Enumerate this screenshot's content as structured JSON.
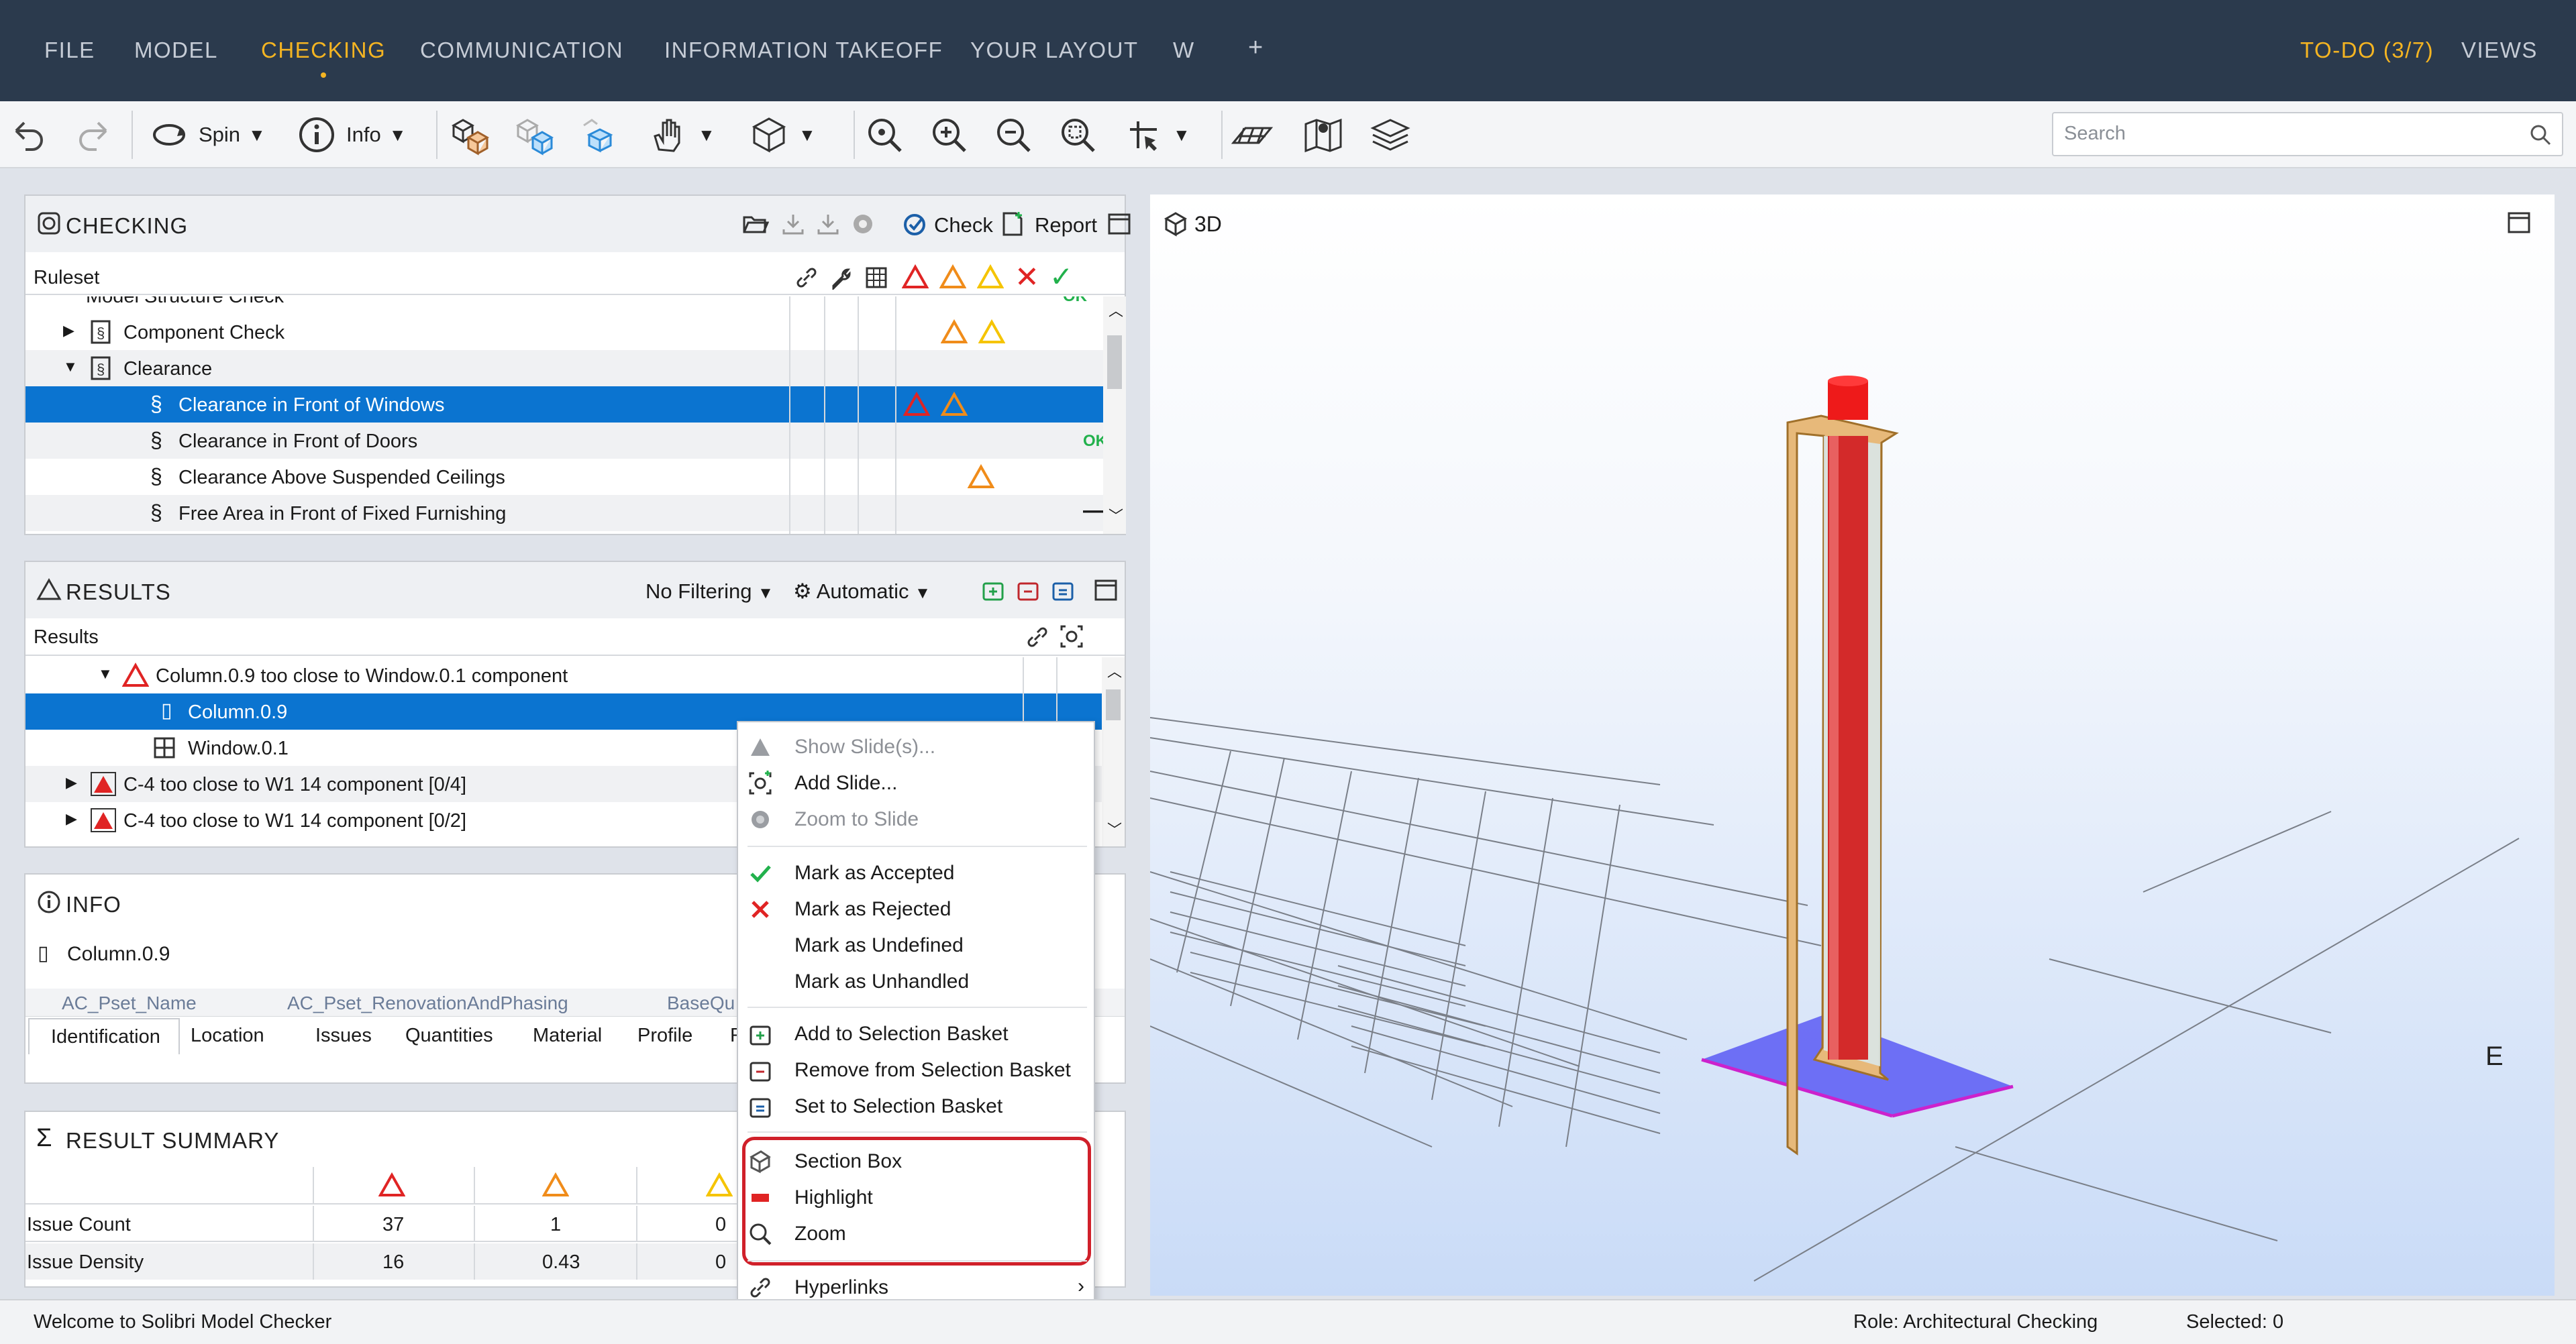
{
  "menu": {
    "items": [
      "FILE",
      "MODEL",
      "CHECKING",
      "COMMUNICATION",
      "INFORMATION TAKEOFF",
      "YOUR LAYOUT",
      "W",
      "+"
    ],
    "active": "CHECKING",
    "todo": "TO-DO (3/7)",
    "views": "VIEWS"
  },
  "toolbar": {
    "spin_label": "Spin",
    "info_label": "Info"
  },
  "search": {
    "placeholder": "Search"
  },
  "checking": {
    "title": "CHECKING",
    "check_label": "Check",
    "report_label": "Report",
    "column_header": "Ruleset",
    "rows": [
      {
        "label": "Model Structure Check",
        "status": "OK"
      },
      {
        "label": "Component Check",
        "status": "warn"
      },
      {
        "label": "Clearance",
        "status": ""
      },
      {
        "label": "Clearance in Front of Windows",
        "status": "critical"
      },
      {
        "label": "Clearance in Front of Doors",
        "status": "OK"
      },
      {
        "label": "Clearance Above Suspended Ceilings",
        "status": "moderate"
      },
      {
        "label": "Free Area in Front of Fixed Furnishing",
        "status": "—"
      }
    ],
    "ok_text": "OK",
    "dash_text": "—"
  },
  "results": {
    "title": "RESULTS",
    "filter": "No Filtering",
    "mode": "Automatic",
    "column_header": "Results",
    "rows": [
      "Column.0.9 too close to Window.0.1 component",
      "Column.0.9",
      "Window.0.1",
      "C-4 too close to W1 14 component [0/4]",
      "C-4 too close to W1 14 component [0/2]"
    ]
  },
  "info": {
    "title": "INFO",
    "object": "Column.0.9",
    "subheaders": [
      "AC_Pset_Name",
      "AC_Pset_RenovationAndPhasing",
      "BaseQu"
    ],
    "tabs": [
      "Identification",
      "Location",
      "Issues",
      "Quantities",
      "Material",
      "Profile",
      "R"
    ],
    "active_tab": "Identification"
  },
  "summary": {
    "title": "RESULT SUMMARY",
    "rows": [
      {
        "label": "Issue Count",
        "values": [
          "37",
          "1",
          "0"
        ]
      },
      {
        "label": "Issue Density",
        "values": [
          "16",
          "0.43",
          "0"
        ]
      }
    ]
  },
  "context_menu": {
    "items": [
      {
        "label": "Show Slide(s)...",
        "icon": "triangle-icon",
        "disabled": true
      },
      {
        "label": "Add Slide...",
        "icon": "add-slide-icon",
        "disabled": false
      },
      {
        "label": "Zoom to Slide",
        "icon": "zoom-slide-icon",
        "disabled": true
      },
      {
        "label": "Mark as Accepted",
        "icon": "check-icon",
        "disabled": false
      },
      {
        "label": "Mark as Rejected",
        "icon": "x-icon",
        "disabled": false
      },
      {
        "label": "Mark as Undefined",
        "icon": "",
        "disabled": false
      },
      {
        "label": "Mark as Unhandled",
        "icon": "",
        "disabled": false
      },
      {
        "label": "Add to Selection Basket",
        "icon": "basket-add-icon",
        "disabled": false
      },
      {
        "label": "Remove from Selection Basket",
        "icon": "basket-remove-icon",
        "disabled": false
      },
      {
        "label": "Set to Selection Basket",
        "icon": "basket-set-icon",
        "disabled": false
      },
      {
        "label": "Section Box",
        "icon": "section-box-icon",
        "disabled": false
      },
      {
        "label": "Highlight",
        "icon": "highlight-icon",
        "disabled": false
      },
      {
        "label": "Zoom",
        "icon": "zoom-icon",
        "disabled": false
      },
      {
        "label": "Hyperlinks",
        "icon": "link-icon",
        "disabled": false
      }
    ]
  },
  "view3d": {
    "title": "3D",
    "axis_label": "E"
  },
  "status": {
    "welcome": "Welcome to Solibri Model Checker",
    "role": "Role: Architectural Checking",
    "selected": "Selected: 0"
  },
  "colors": {
    "menubar": "#2b3a4d",
    "accent": "#f4b422",
    "selection": "#0b74d0",
    "critical": "#e02424",
    "moderate": "#f08c1a",
    "low": "#f5c400",
    "ok": "#22b14c",
    "highlight_box": "#d0202a"
  }
}
